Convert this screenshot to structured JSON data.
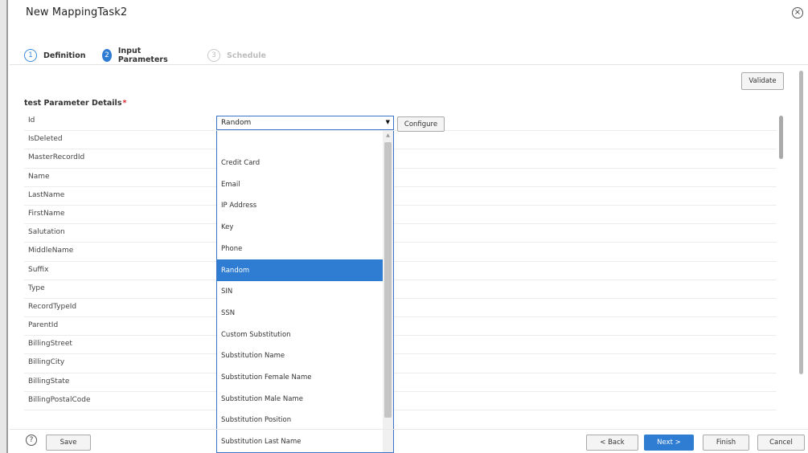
{
  "window": {
    "title": "New MappingTask2",
    "close_icon": "×"
  },
  "steps": [
    {
      "num": "1",
      "label": "Definition",
      "state": "done"
    },
    {
      "num": "2",
      "label": "Input Parameters",
      "state": "active"
    },
    {
      "num": "3",
      "label": "Schedule",
      "state": "pending"
    }
  ],
  "toolbar": {
    "validate_label": "Validate"
  },
  "section": {
    "title": "test Parameter Details",
    "required_mark": "*"
  },
  "fields": [
    "Id",
    "IsDeleted",
    "MasterRecordId",
    "Name",
    "LastName",
    "FirstName",
    "Salutation",
    "MiddleName",
    "Suffix",
    "Type",
    "RecordTypeId",
    "ParentId",
    "BillingStreet",
    "BillingCity",
    "BillingState",
    "BillingPostalCode"
  ],
  "masking": {
    "selected": "Random",
    "arrow": "▼",
    "configure_label": "Configure",
    "options": [
      "",
      "Credit Card",
      "Email",
      "IP Address",
      "Key",
      "Phone",
      "Random",
      "SIN",
      "SSN",
      "Custom Substitution",
      "Substitution Name",
      "Substitution Female Name",
      "Substitution Male Name",
      "Substitution Position",
      "Substitution Last Name"
    ],
    "selected_index": 6
  },
  "footer": {
    "help_icon": "?",
    "save_label": "Save",
    "back_label": "< Back",
    "next_label": "Next >",
    "finish_label": "Finish",
    "cancel_label": "Cancel"
  }
}
